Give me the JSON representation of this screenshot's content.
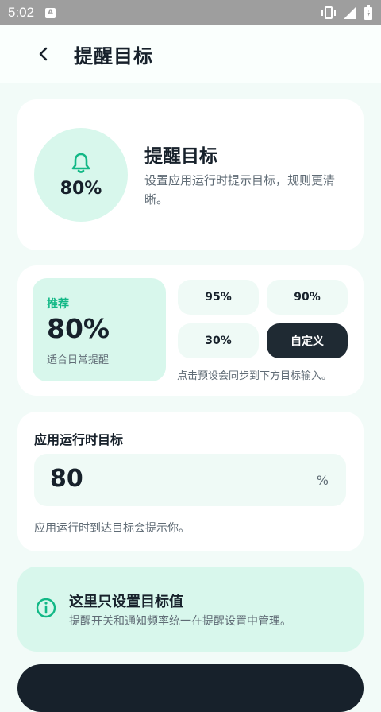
{
  "status": {
    "time": "5:02",
    "notif_icon": "A"
  },
  "header": {
    "title": "提醒目标"
  },
  "summary": {
    "value": "80%",
    "title": "提醒目标",
    "description": "设置应用运行时提示目标，规则更清晰。"
  },
  "presets": {
    "recommended_label": "推荐",
    "recommended_value": "80%",
    "recommended_sub": "适合日常提醒",
    "options": [
      "95%",
      "90%",
      "30%",
      "自定义"
    ],
    "hint": "点击预设会同步到下方目标输入。"
  },
  "target_input": {
    "label": "应用运行时目标",
    "value": "80",
    "unit": "%",
    "help": "应用运行时到达目标会提示你。"
  },
  "info": {
    "title": "这里只设置目标值",
    "description": "提醒开关和通知频率统一在提醒设置中管理。"
  },
  "colors": {
    "accent": "#12b886",
    "mint": "#d8f7ec",
    "dark": "#17212b"
  }
}
